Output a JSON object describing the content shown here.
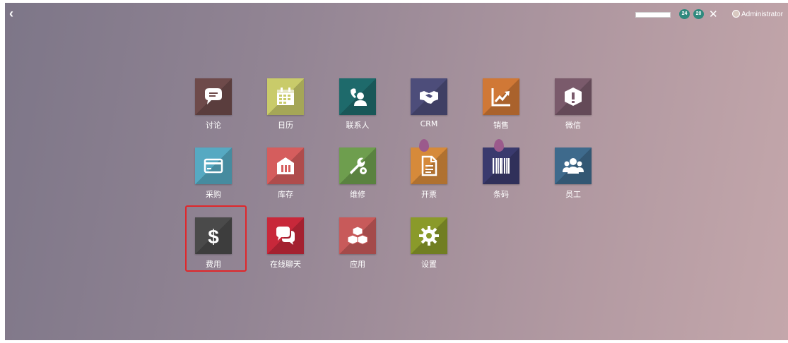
{
  "topbar": {
    "back_icon": "chevron-left-icon",
    "progress_percent": 100,
    "badges": [
      {
        "icon": "chat-bubble-icon",
        "count": "24"
      },
      {
        "icon": "chat-bubble-icon",
        "count": "20"
      }
    ],
    "user_name": "Administrator"
  },
  "apps": [
    {
      "label": "讨论",
      "icon": "speech-bubble-icon",
      "color": "#6e4a4a"
    },
    {
      "label": "日历",
      "icon": "calendar-icon",
      "color": "#c9cb6a"
    },
    {
      "label": "联系人",
      "icon": "contact-phone-icon",
      "color": "#1e6a6b"
    },
    {
      "label": "CRM",
      "icon": "handshake-icon",
      "color": "#4d4d7a"
    },
    {
      "label": "销售",
      "icon": "trend-chart-icon",
      "color": "#d07836"
    },
    {
      "label": "微信",
      "icon": "box-exclamation-icon",
      "color": "#7a5a6b"
    },
    {
      "label": "采购",
      "icon": "credit-card-icon",
      "color": "#56a9c2"
    },
    {
      "label": "库存",
      "icon": "warehouse-icon",
      "color": "#d55d5d"
    },
    {
      "label": "维修",
      "icon": "wrench-gear-icon",
      "color": "#6e9e4e"
    },
    {
      "label": "开票",
      "icon": "invoice-icon",
      "color": "#d68a3a"
    },
    {
      "label": "条码",
      "icon": "barcode-icon",
      "color": "#3a3a6e"
    },
    {
      "label": "员工",
      "icon": "people-icon",
      "color": "#3e6a8c"
    },
    {
      "label": "费用",
      "icon": "dollar-icon",
      "color": "#4a4a4a"
    },
    {
      "label": "在线聊天",
      "icon": "chat-bubbles-icon",
      "color": "#c8283a"
    },
    {
      "label": "应用",
      "icon": "cubes-icon",
      "color": "#c85a5a"
    },
    {
      "label": "设置",
      "icon": "gear-icon",
      "color": "#8a9a2a"
    }
  ],
  "highlighted_app": "费用",
  "highlight_color": "#e0272b"
}
